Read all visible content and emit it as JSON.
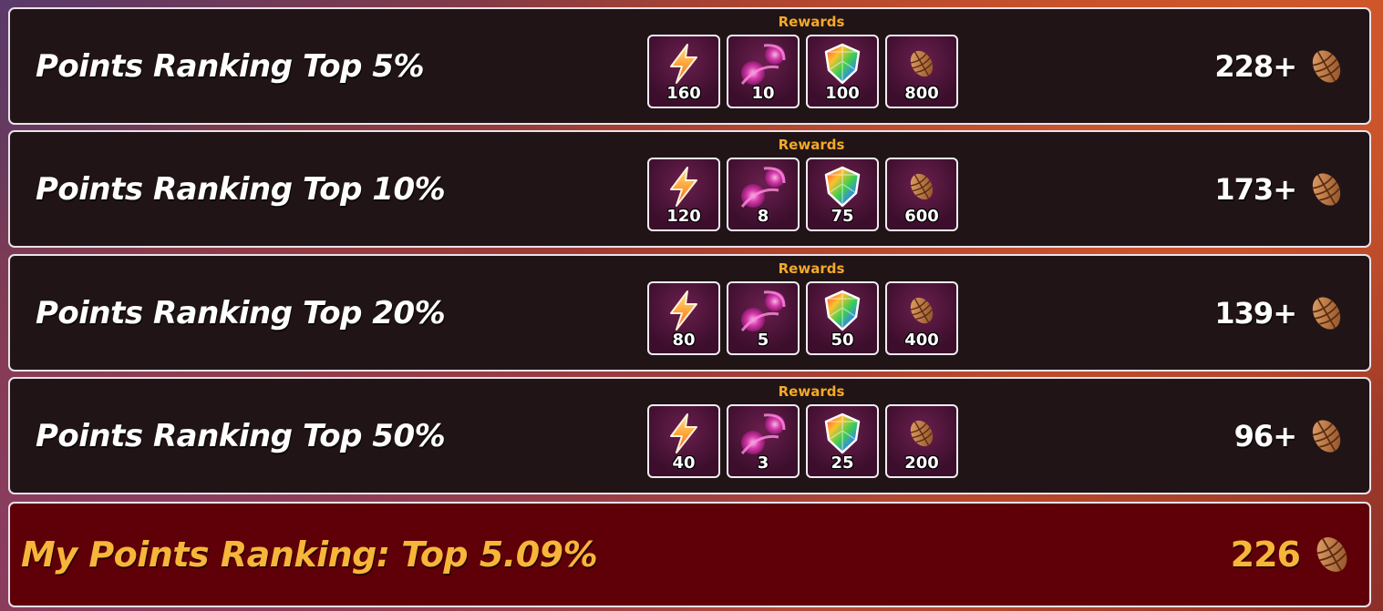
{
  "colors": {
    "panel_bg": "#201416",
    "highlight_bg": "#5f0008",
    "rewards_label": "#f4a928",
    "my_ranking_text": "#f7b53a"
  },
  "icons": {
    "energy": "lightning-bolt-icon",
    "magic": "pink-magic-swirl-icon",
    "gem": "rainbow-gem-shield-icon",
    "cone": "pine-cone-icon"
  },
  "tiers": [
    {
      "title": "Points Ranking Top 5%",
      "rewards_label": "Rewards",
      "rewards": [
        "160",
        "10",
        "100",
        "800"
      ],
      "threshold": "228+"
    },
    {
      "title": "Points Ranking Top 10%",
      "rewards_label": "Rewards",
      "rewards": [
        "120",
        "8",
        "75",
        "600"
      ],
      "threshold": "173+"
    },
    {
      "title": "Points Ranking Top 20%",
      "rewards_label": "Rewards",
      "rewards": [
        "80",
        "5",
        "50",
        "400"
      ],
      "threshold": "139+"
    },
    {
      "title": "Points Ranking Top 50%",
      "rewards_label": "Rewards",
      "rewards": [
        "40",
        "3",
        "25",
        "200"
      ],
      "threshold": "96+"
    }
  ],
  "my_ranking": {
    "title": "My Points Ranking: Top 5.09%",
    "points": "226"
  }
}
